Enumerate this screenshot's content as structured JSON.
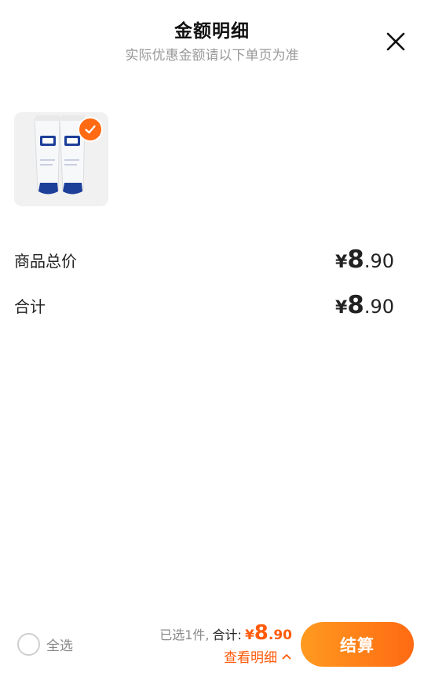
{
  "header": {
    "title": "金额明细",
    "subtitle": "实际优惠金额请以下单页为准"
  },
  "icons": {
    "close": "close-icon",
    "check": "check-icon",
    "chevron": "chevron-up-icon"
  },
  "product": {
    "image": "product-image",
    "selected": true
  },
  "rows": [
    {
      "label": "商品总价",
      "yen": "¥",
      "int": "8",
      "dec": ".90"
    },
    {
      "label": "合计",
      "yen": "¥",
      "int": "8",
      "dec": ".90"
    }
  ],
  "bottom": {
    "select_all": "全选",
    "selected_count": "已选1件,",
    "total_label": "合计:",
    "total_yen": "¥",
    "total_int": "8",
    "total_dec": ".90",
    "detail_link": "查看明细",
    "checkout": "结算"
  },
  "colors": {
    "accent": "#ff6a13",
    "accent_gradient_start": "#ff9a1f",
    "muted_text": "#999999"
  }
}
